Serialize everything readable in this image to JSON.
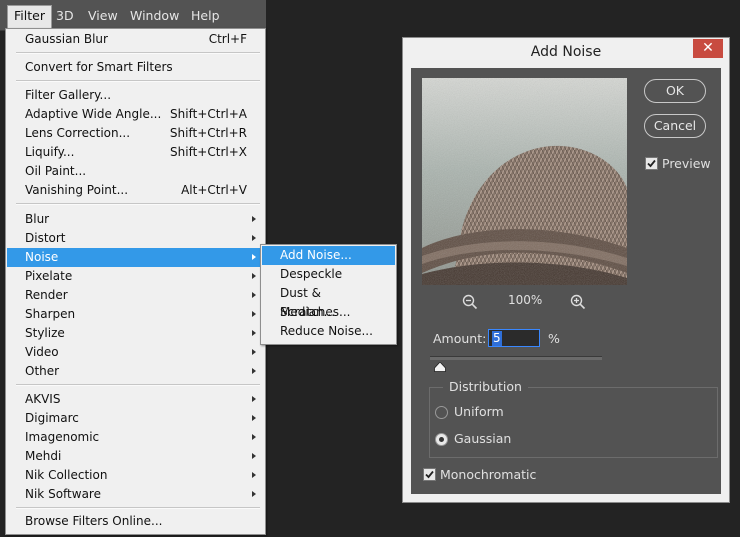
{
  "menubar": {
    "items": [
      "Filter",
      "3D",
      "View",
      "Window",
      "Help"
    ]
  },
  "filter_menu": {
    "items": [
      {
        "label": "Gaussian Blur",
        "shortcut": "Ctrl+F"
      },
      {
        "label": "Convert for Smart Filters",
        "shortcut": ""
      },
      {
        "label": "Filter Gallery...",
        "shortcut": ""
      },
      {
        "label": "Adaptive Wide Angle...",
        "shortcut": "Shift+Ctrl+A"
      },
      {
        "label": "Lens Correction...",
        "shortcut": "Shift+Ctrl+R"
      },
      {
        "label": "Liquify...",
        "shortcut": "Shift+Ctrl+X"
      },
      {
        "label": "Oil Paint...",
        "shortcut": ""
      },
      {
        "label": "Vanishing Point...",
        "shortcut": "Alt+Ctrl+V"
      },
      {
        "label": "Blur",
        "shortcut": ""
      },
      {
        "label": "Distort",
        "shortcut": ""
      },
      {
        "label": "Noise",
        "shortcut": ""
      },
      {
        "label": "Pixelate",
        "shortcut": ""
      },
      {
        "label": "Render",
        "shortcut": ""
      },
      {
        "label": "Sharpen",
        "shortcut": ""
      },
      {
        "label": "Stylize",
        "shortcut": ""
      },
      {
        "label": "Video",
        "shortcut": ""
      },
      {
        "label": "Other",
        "shortcut": ""
      },
      {
        "label": "AKVIS",
        "shortcut": ""
      },
      {
        "label": "Digimarc",
        "shortcut": ""
      },
      {
        "label": "Imagenomic",
        "shortcut": ""
      },
      {
        "label": "Mehdi",
        "shortcut": ""
      },
      {
        "label": "Nik Collection",
        "shortcut": ""
      },
      {
        "label": "Nik Software",
        "shortcut": ""
      },
      {
        "label": "Browse Filters Online...",
        "shortcut": ""
      }
    ]
  },
  "noise_submenu": {
    "items": [
      "Add Noise...",
      "Despeckle",
      "Dust & Scratches...",
      "Median...",
      "Reduce Noise..."
    ]
  },
  "dialog": {
    "title": "Add Noise",
    "close_glyph": "✕",
    "ok_label": "OK",
    "cancel_label": "Cancel",
    "preview_label": "Preview",
    "preview_checked": true,
    "zoom_level": "100%",
    "amount_label": "Amount:",
    "amount_value": "5",
    "amount_unit": "%",
    "slider_fraction": 0.012,
    "distribution_title": "Distribution",
    "uniform_label": "Uniform",
    "gaussian_label": "Gaussian",
    "selected_distribution": "Gaussian",
    "monochromatic_label": "Monochromatic",
    "monochromatic_checked": true
  },
  "colors": {
    "highlight": "#3399e8",
    "close_button": "#c84b40",
    "dialog_panel": "#535353"
  }
}
